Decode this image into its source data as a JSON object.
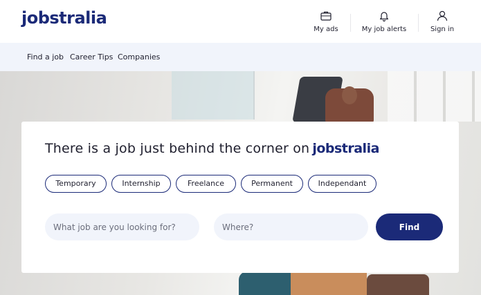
{
  "header": {
    "logo": "jobstralia",
    "items": [
      {
        "label": "My ads",
        "icon": "briefcase-icon"
      },
      {
        "label": "My job alerts",
        "icon": "bell-icon"
      },
      {
        "label": "Sign in",
        "icon": "user-icon"
      }
    ]
  },
  "nav": {
    "items": [
      {
        "label": "Find a job"
      },
      {
        "label": "Career Tips"
      },
      {
        "label": "Companies"
      }
    ]
  },
  "search": {
    "headline": "There is a job just behind the corner on",
    "headline_logo": "jobstralia",
    "job_types": [
      "Temporary",
      "Internship",
      "Freelance",
      "Permanent",
      "Independant"
    ],
    "what_placeholder": "What job are you looking for?",
    "where_placeholder": "Where?",
    "find_label": "Find"
  },
  "colors": {
    "brand": "#1b2a78",
    "nav_bg": "#f1f4fb",
    "input_bg": "#f1f4fb"
  }
}
